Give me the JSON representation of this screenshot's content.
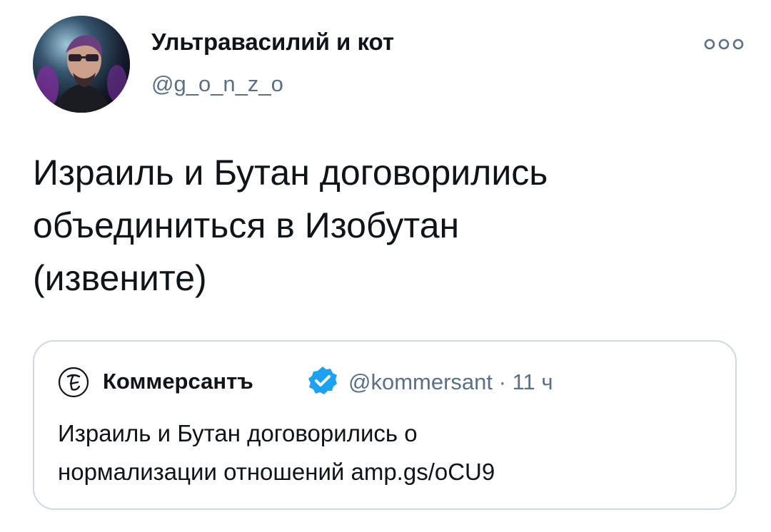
{
  "tweet": {
    "author": {
      "name": "Ультравасилий и кот",
      "handle": "@g_o_n_z_o",
      "avatar_icon": "user-avatar-photo"
    },
    "more_icon": "more-options-icon",
    "text": "Израиль и Бутан договорились\nобъединиться в Изобутан\n(извените)"
  },
  "quoted_tweet": {
    "logo_icon": "kommersant-logo-icon",
    "name": "Коммерсантъ",
    "verified_icon": "verified-badge-icon",
    "verified_color": "#1da1f2",
    "handle": "@kommersant",
    "separator": "·",
    "time": "11 ч",
    "text": "Израиль и Бутан договорились о\nнормализации отношений amp.gs/oCU9"
  },
  "colors": {
    "text": "#0f1419",
    "secondary": "#5b7083",
    "border": "#cfd9de"
  }
}
